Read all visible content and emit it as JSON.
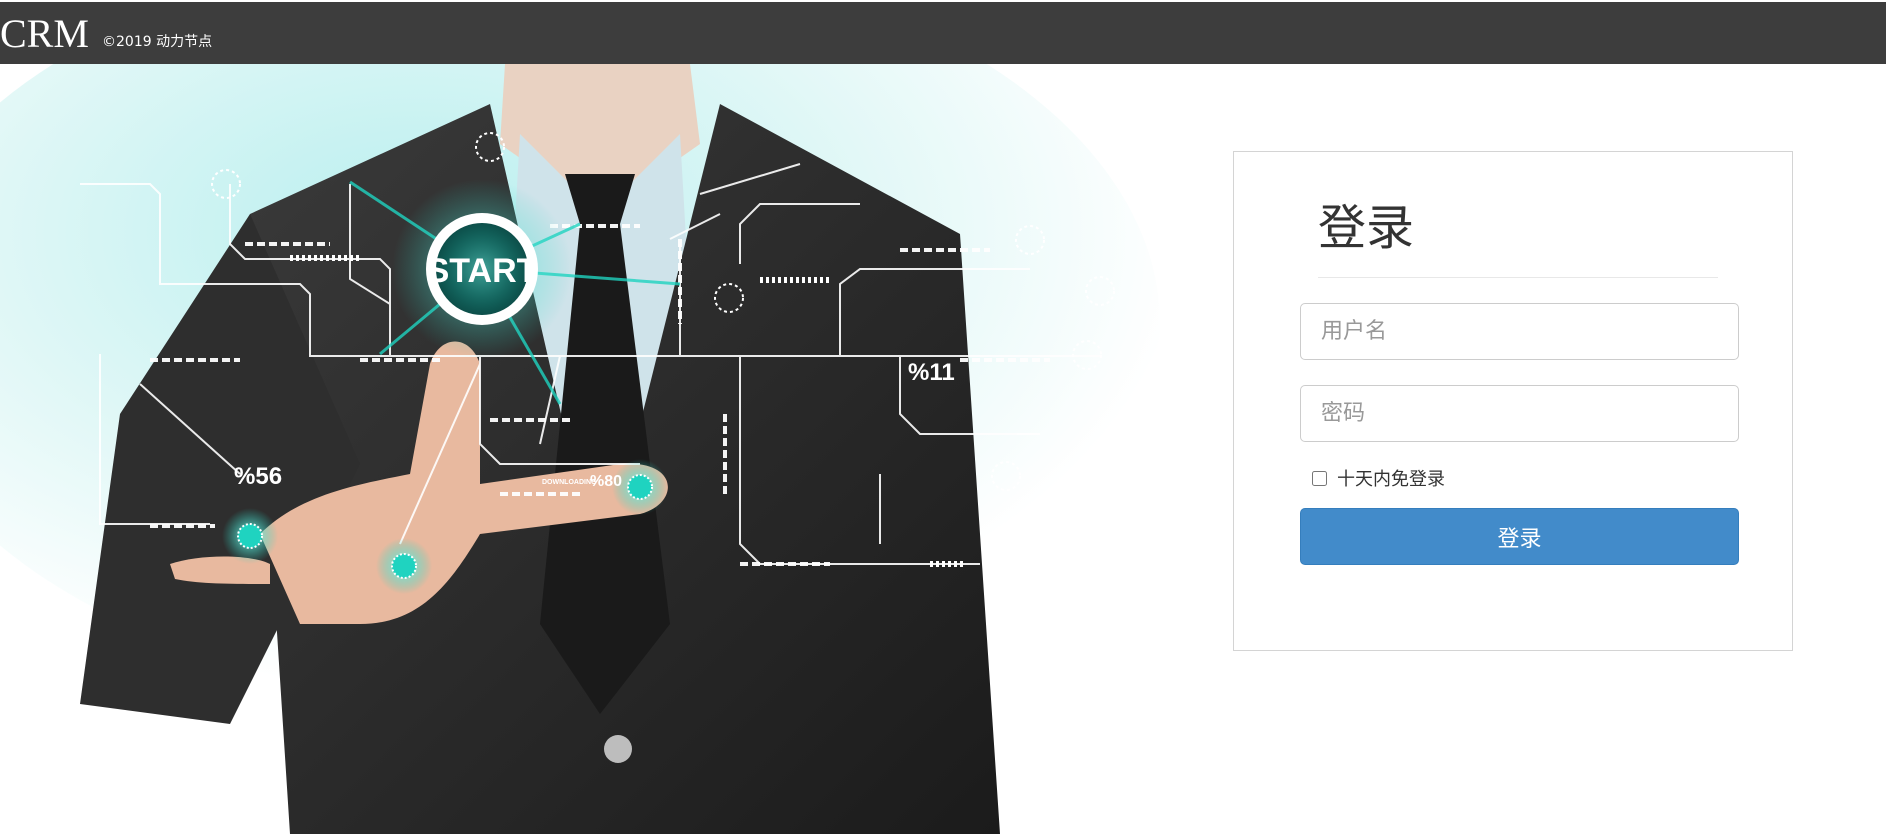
{
  "header": {
    "brand": "CRM",
    "copyright": "©2019 动力节点"
  },
  "hero": {
    "start_label": "START",
    "stats": [
      "%11",
      "%56",
      "%80",
      "DOWNLOADING"
    ]
  },
  "login": {
    "title": "登录",
    "username_placeholder": "用户名",
    "password_placeholder": "密码",
    "remember_label": "十天内免登录",
    "submit_label": "登录"
  },
  "colors": {
    "topbar": "#3d3d3d",
    "accent": "#428bca",
    "suit": "#262626",
    "glow": "#1fd3c0"
  }
}
